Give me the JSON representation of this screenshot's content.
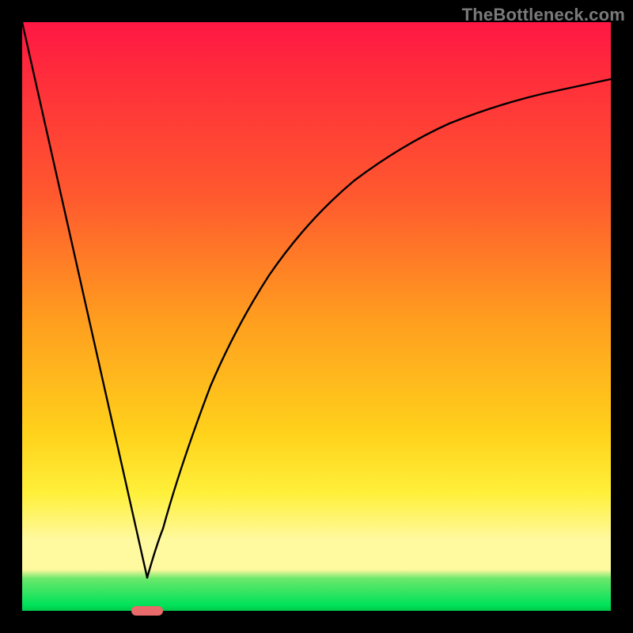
{
  "watermark": "TheBottleneck.com",
  "colors": {
    "frame": "#000000",
    "curve_stroke": "#000000",
    "notch": "#e96a6a",
    "watermark": "#7a7a7a",
    "gradient_top": "#ff1744",
    "gradient_mid1": "#ff9c1f",
    "gradient_mid2": "#fff03a",
    "gradient_band": "#fff9a0",
    "gradient_bottom": "#00c84a"
  },
  "chart_data": {
    "type": "line",
    "title": "",
    "xlabel": "",
    "ylabel": "",
    "xlim": [
      0,
      100
    ],
    "ylim": [
      0,
      100
    ],
    "grid": false,
    "series": [
      {
        "name": "left-descent",
        "x": [
          0,
          5.3,
          10.6,
          15.9,
          21.2
        ],
        "values": [
          100,
          76.4,
          52.8,
          29.2,
          5.6
        ]
      },
      {
        "name": "right-ascent",
        "x": [
          21.2,
          24,
          28,
          32,
          36,
          40,
          45,
          50,
          55,
          60,
          65,
          70,
          75,
          80,
          85,
          90,
          95,
          100
        ],
        "values": [
          5.6,
          14,
          27,
          38,
          47,
          54,
          61,
          67,
          72,
          76,
          79.5,
          82,
          84,
          86,
          87.5,
          89,
          90,
          91
        ]
      }
    ],
    "annotations": [
      {
        "name": "min-notch",
        "x": 21.2,
        "y": 0,
        "color": "#e96a6a"
      }
    ]
  }
}
